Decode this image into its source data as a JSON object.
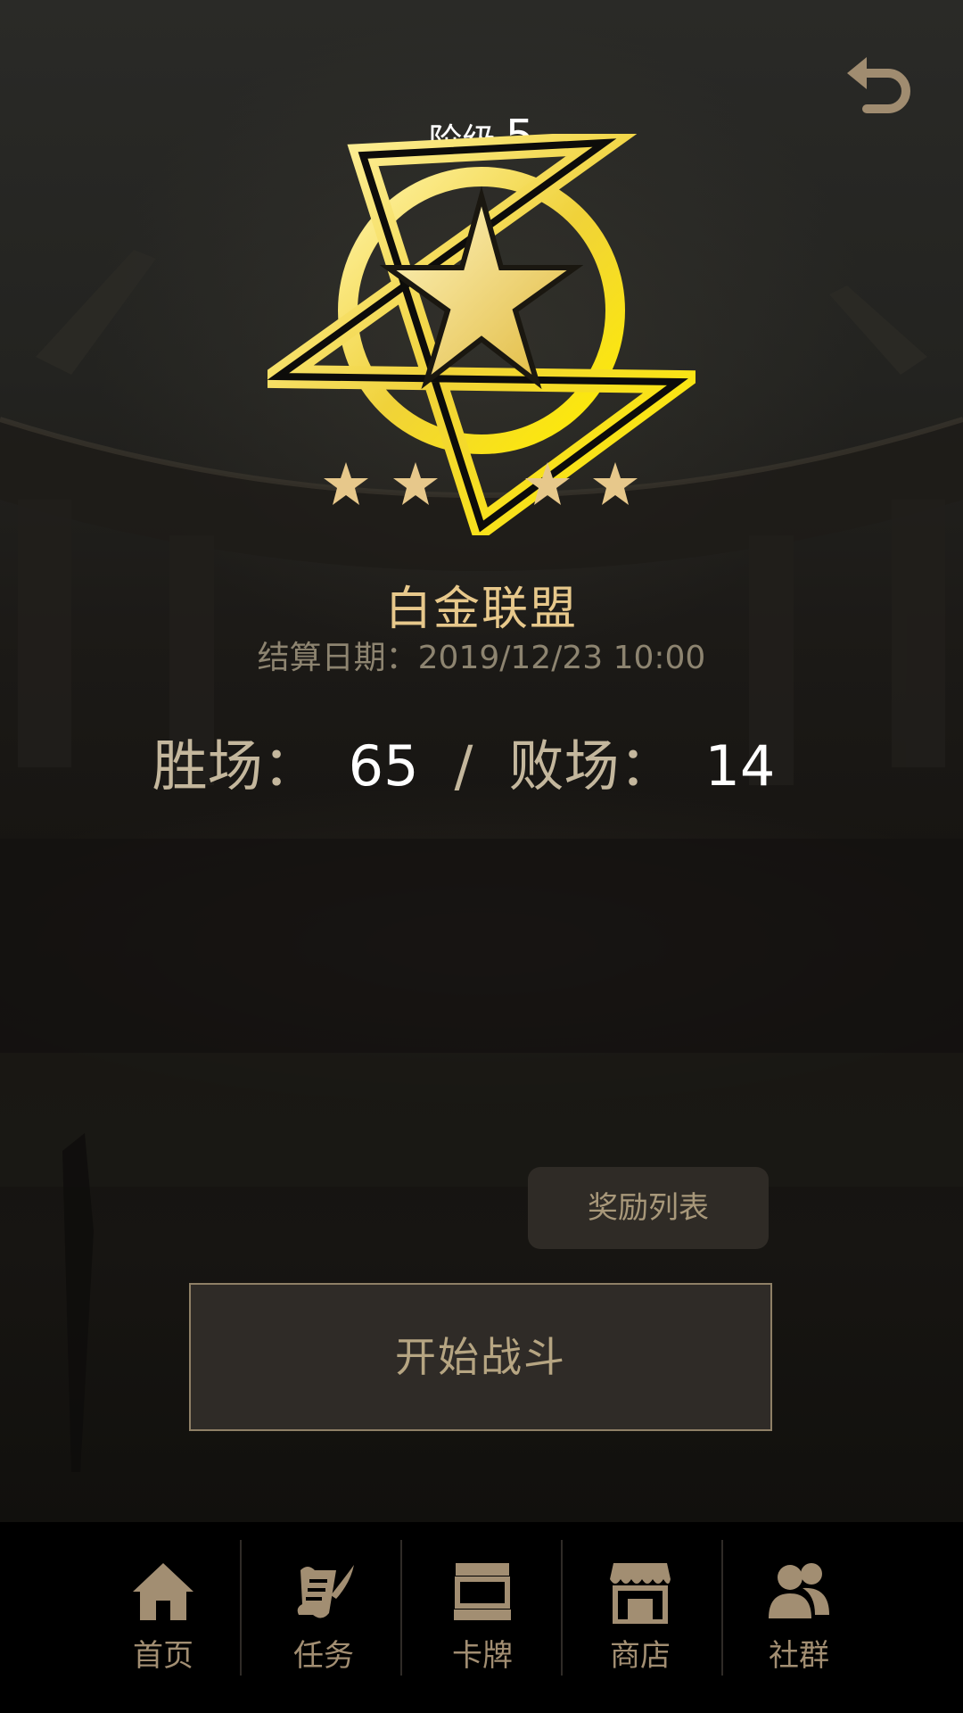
{
  "header": {
    "stage_label": "阶级",
    "stage_number": "5"
  },
  "rank": {
    "tier_name": "白金联盟",
    "settlement": "结算日期：2019/12/23 10:00",
    "stars_filled": 4
  },
  "record": {
    "wins_label": "胜场：",
    "wins": "65",
    "separator": "/",
    "losses_label": "败场：",
    "losses": "14"
  },
  "buttons": {
    "reward_list": "奖励列表",
    "start_battle": "开始战斗"
  },
  "nav": {
    "items": [
      {
        "label": "首页",
        "icon": "home-icon"
      },
      {
        "label": "任务",
        "icon": "quest-scroll-icon"
      },
      {
        "label": "卡牌",
        "icon": "cards-icon"
      },
      {
        "label": "商店",
        "icon": "shop-icon"
      },
      {
        "label": "社群",
        "icon": "community-icon"
      }
    ]
  },
  "colors": {
    "accent": "#e7c88b",
    "text_muted": "#8d8470",
    "button_bg": "#2f2b27",
    "nav_icon": "#a28e72"
  }
}
